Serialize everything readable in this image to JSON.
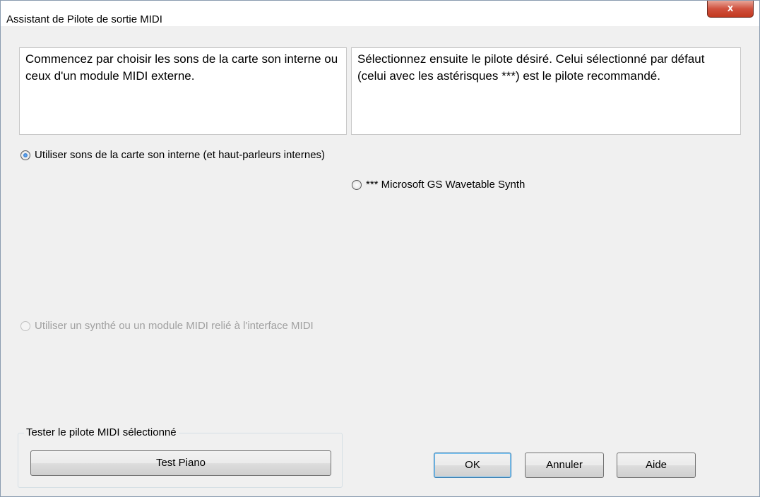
{
  "window": {
    "title": "Assistant de Pilote de sortie MIDI",
    "close_glyph": "x"
  },
  "info": {
    "left_text": "Commencez par choisir les sons de la carte son interne ou ceux d'un module MIDI externe.",
    "right_text": "Sélectionnez ensuite le pilote désiré. Celui sélectionné par défaut (celui avec les astérisques ***) est le pilote recommandé."
  },
  "options": {
    "internal": {
      "label": "Utiliser sons de la carte son interne (et haut-parleurs internes)",
      "selected": true
    },
    "driver": {
      "label": "*** Microsoft GS Wavetable Synth",
      "selected": false
    },
    "external": {
      "label": "Utiliser un synthé ou un module MIDI relié à l'interface MIDI",
      "enabled": false
    }
  },
  "test_group": {
    "label": "Tester le pilote MIDI sélectionné",
    "button": "Test Piano"
  },
  "buttons": {
    "ok": "OK",
    "cancel": "Annuler",
    "help": "Aide"
  }
}
